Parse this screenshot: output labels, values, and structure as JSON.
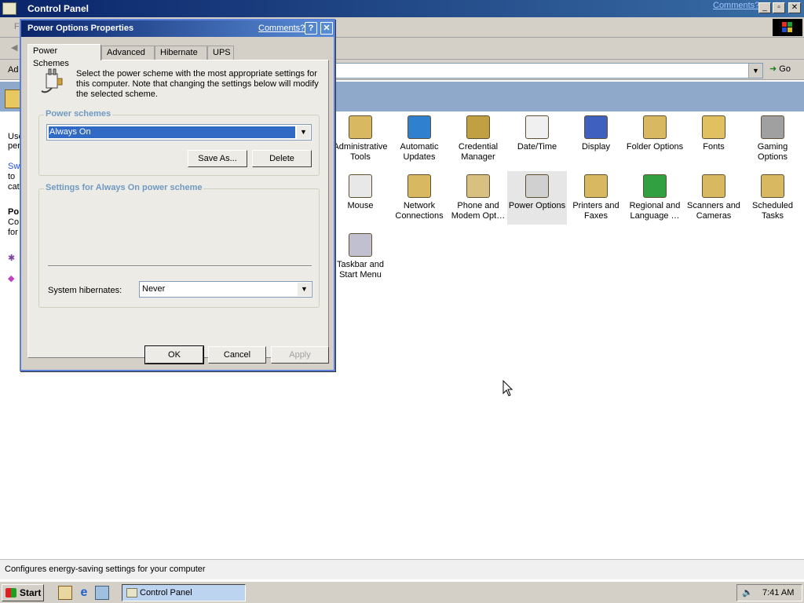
{
  "window": {
    "title": "Control Panel",
    "comments_link": "Comments?",
    "menu_letter": "F",
    "address_label": "Ad",
    "go_label": "Go",
    "status_text": "Configures energy-saving settings for your computer"
  },
  "left_pane": {
    "fragments": [
      "Use",
      "per",
      "Sw",
      "to",
      "cat",
      "Po",
      "Co",
      "for"
    ]
  },
  "icons": [
    {
      "label": "Administrative Tools",
      "icon": "admin-tools-icon",
      "selected": false
    },
    {
      "label": "Automatic Updates",
      "icon": "globe-update-icon",
      "selected": false
    },
    {
      "label": "Credential Manager",
      "icon": "keys-icon",
      "selected": false
    },
    {
      "label": "Date/Time",
      "icon": "calendar-clock-icon",
      "selected": false
    },
    {
      "label": "Display",
      "icon": "monitor-icon",
      "selected": false
    },
    {
      "label": "Folder Options",
      "icon": "folder-options-icon",
      "selected": false
    },
    {
      "label": "Fonts",
      "icon": "fonts-folder-icon",
      "selected": false
    },
    {
      "label": "Gaming Options",
      "icon": "joystick-icon",
      "selected": false
    },
    {
      "label": "Mouse",
      "icon": "mouse-icon",
      "selected": false
    },
    {
      "label": "Network Connections",
      "icon": "network-folder-icon",
      "selected": false
    },
    {
      "label": "Phone and Modem Opt…",
      "icon": "phone-icon",
      "selected": false
    },
    {
      "label": "Power Options",
      "icon": "power-plug-icon",
      "selected": true
    },
    {
      "label": "Printers and Faxes",
      "icon": "printer-folder-icon",
      "selected": false
    },
    {
      "label": "Regional and Language …",
      "icon": "globe-icon",
      "selected": false
    },
    {
      "label": "Scanners and Cameras",
      "icon": "scanner-folder-icon",
      "selected": false
    },
    {
      "label": "Scheduled Tasks",
      "icon": "tasks-folder-icon",
      "selected": false
    },
    {
      "label": "Taskbar and Start Menu",
      "icon": "taskbar-icon",
      "selected": false
    }
  ],
  "dialog": {
    "title": "Power Options Properties",
    "comments_link": "Comments?",
    "help": "?",
    "close": "✕",
    "tabs": [
      "Power Schemes",
      "Advanced",
      "Hibernate",
      "UPS"
    ],
    "active_tab": "Power Schemes",
    "description": "Select the power scheme with the most appropriate settings for this computer. Note that changing the settings below will modify the selected scheme.",
    "schemes_group": "Power schemes",
    "scheme_value": "Always On",
    "save_as": "Save As...",
    "delete": "Delete",
    "settings_group": "Settings for Always On power scheme",
    "hibernate_label": "System hibernates:",
    "hibernate_value": "Never",
    "ok": "OK",
    "cancel": "Cancel",
    "apply": "Apply"
  },
  "taskbar": {
    "start": "Start",
    "task": "Control Panel",
    "clock": "7:41 AM"
  },
  "colors": {
    "titlebar": "#0a246a",
    "selection": "#316ac5",
    "group_label": "#6f9ac2",
    "band": "#8ea9c9"
  }
}
